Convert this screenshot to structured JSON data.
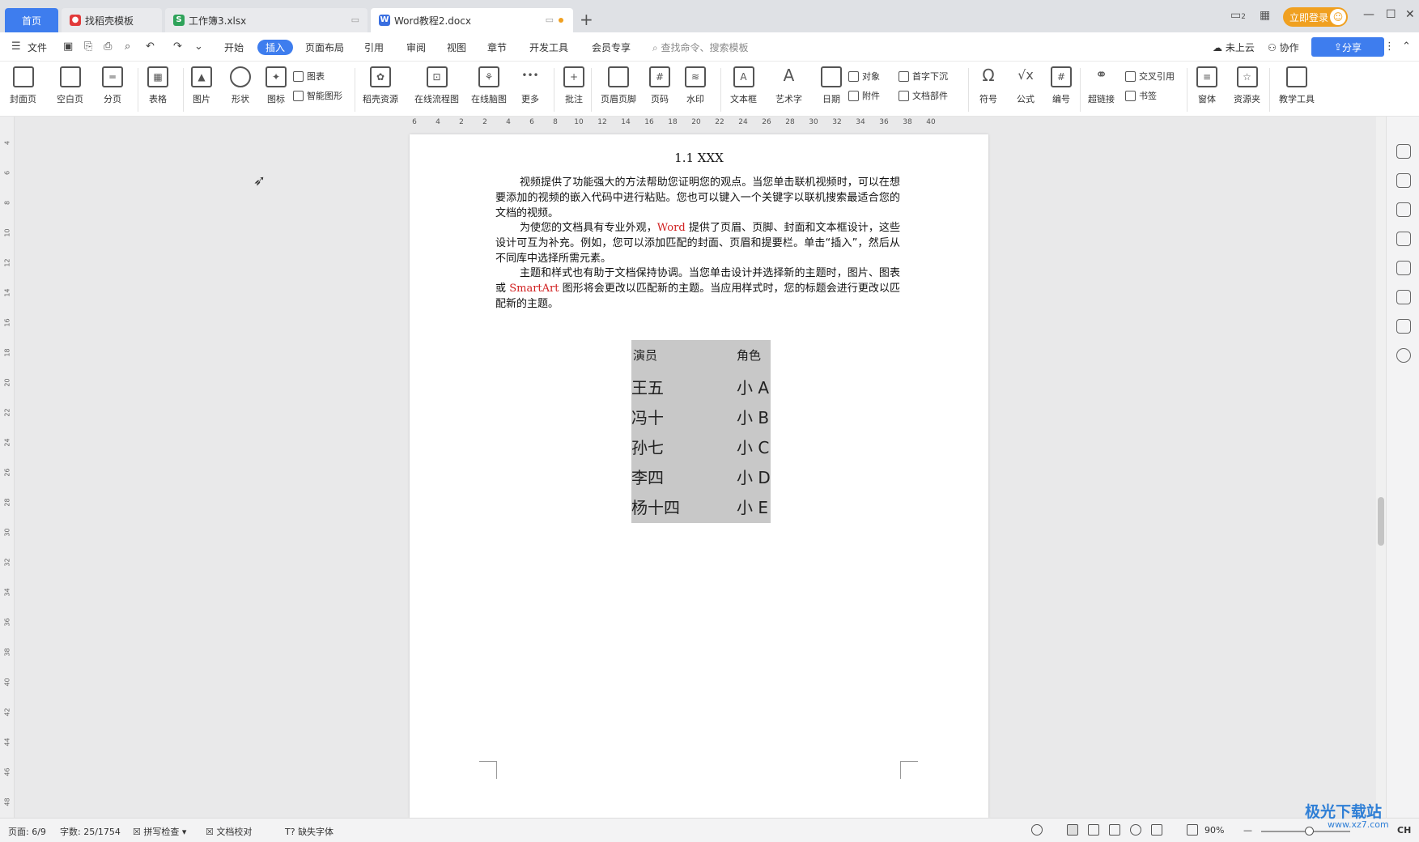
{
  "tabs": {
    "home": "首页",
    "t1": "找稻壳模板",
    "t2": "工作簿3.xlsx",
    "t3": "Word教程2.docx",
    "new": "+"
  },
  "titlebar": {
    "login": "立即登录",
    "page_indicator": "2"
  },
  "menu": {
    "file": "文件",
    "items": [
      "开始",
      "插入",
      "页面布局",
      "引用",
      "审阅",
      "视图",
      "章节",
      "开发工具",
      "会员专享"
    ],
    "search_placeholder": "查找命令、搜索模板",
    "cloud": "未上云",
    "collab": "协作",
    "share": "分享"
  },
  "ribbon": {
    "large": [
      "封面页",
      "空白页",
      "分页",
      "表格",
      "图片",
      "形状",
      "图标",
      "稻壳资源",
      "在线流程图",
      "在线脑图",
      "更多",
      "批注",
      "页眉页脚",
      "页码",
      "水印",
      "文本框",
      "艺术字",
      "日期",
      "符号",
      "公式",
      "编号",
      "超链接",
      "窗体",
      "资源夹",
      "教学工具"
    ],
    "small": [
      "图表",
      "智能图形",
      "对象",
      "附件",
      "首字下沉",
      "文档部件",
      "交叉引用",
      "书签"
    ]
  },
  "ruler": {
    "h": [
      "6",
      "4",
      "2",
      "2",
      "4",
      "6",
      "8",
      "10",
      "12",
      "14",
      "16",
      "18",
      "20",
      "22",
      "24",
      "26",
      "28",
      "30",
      "32",
      "34",
      "36",
      "38",
      "40"
    ],
    "v": [
      "4",
      "6",
      "8",
      "10",
      "12",
      "14",
      "16",
      "18",
      "20",
      "22",
      "24",
      "26",
      "28",
      "30",
      "32",
      "34",
      "36",
      "38",
      "40",
      "42",
      "44",
      "46",
      "48"
    ]
  },
  "document": {
    "heading": "1.1 XXX",
    "p1": "视频提供了功能强大的方法帮助您证明您的观点。当您单击联机视频时，可以在想要添加的视频的嵌入代码中进行粘贴。您也可以键入一个关键字以联机搜索最适合您的文档的视频。",
    "p2a": "为使您的文档具有专业外观，",
    "p2red": "Word",
    "p2b": " 提供了页眉、页脚、封面和文本框设计，这些设计可互为补充。例如，您可以添加匹配的封面、页眉和提要栏。单击“插入”，然后从不同库中选择所需元素。",
    "p3a": "主题和样式也有助于文档保持协调。当您单击设计并选择新的主题时，图片、图表或 ",
    "p3red": "SmartArt",
    "p3b": " 图形将会更改以匹配新的主题。当应用样式时，您的标题会进行更改以匹配新的主题。",
    "table": {
      "headers": [
        "演员",
        "角色"
      ],
      "rows": [
        [
          "王五",
          "小 A"
        ],
        [
          "冯十",
          "小 B"
        ],
        [
          "孙七",
          "小 C"
        ],
        [
          "李四",
          "小 D"
        ],
        [
          "杨十四",
          "小 E"
        ]
      ]
    }
  },
  "status": {
    "page": "页面: 6/9",
    "words": "字数: 25/1754",
    "spell": "拼写检查",
    "proof": "文档校对",
    "missing_font": "缺失字体",
    "zoom": "90%",
    "ime": "CH"
  },
  "watermark": {
    "line1": "极光下载站",
    "line2": "www.xz7.com"
  }
}
